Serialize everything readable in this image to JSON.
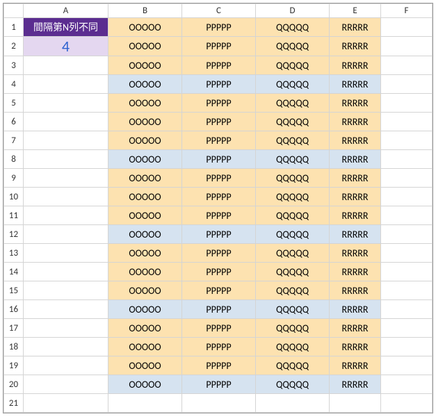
{
  "columns": [
    "A",
    "B",
    "C",
    "D",
    "E",
    "F"
  ],
  "row_numbers": [
    1,
    2,
    3,
    4,
    5,
    6,
    7,
    8,
    9,
    10,
    11,
    12,
    13,
    14,
    15,
    16,
    17,
    18,
    19,
    20,
    21
  ],
  "a1_header": "間隔第N列不同",
  "a2_value": "4",
  "interval_highlight_row": 4,
  "data_text": {
    "B": "OOOOO",
    "C": "PPPPP",
    "D": "QQQQQ",
    "E": "RRRRR"
  },
  "data_row_count": 20,
  "colors": {
    "header_purple_bg": "#5b2d90",
    "header_purple_fg": "#ffffff",
    "lavender_bg": "#e4d7f0",
    "lavender_fg": "#2e62d0",
    "stripe_orange": "#fde2b0",
    "stripe_blue": "#d6e3f0"
  }
}
